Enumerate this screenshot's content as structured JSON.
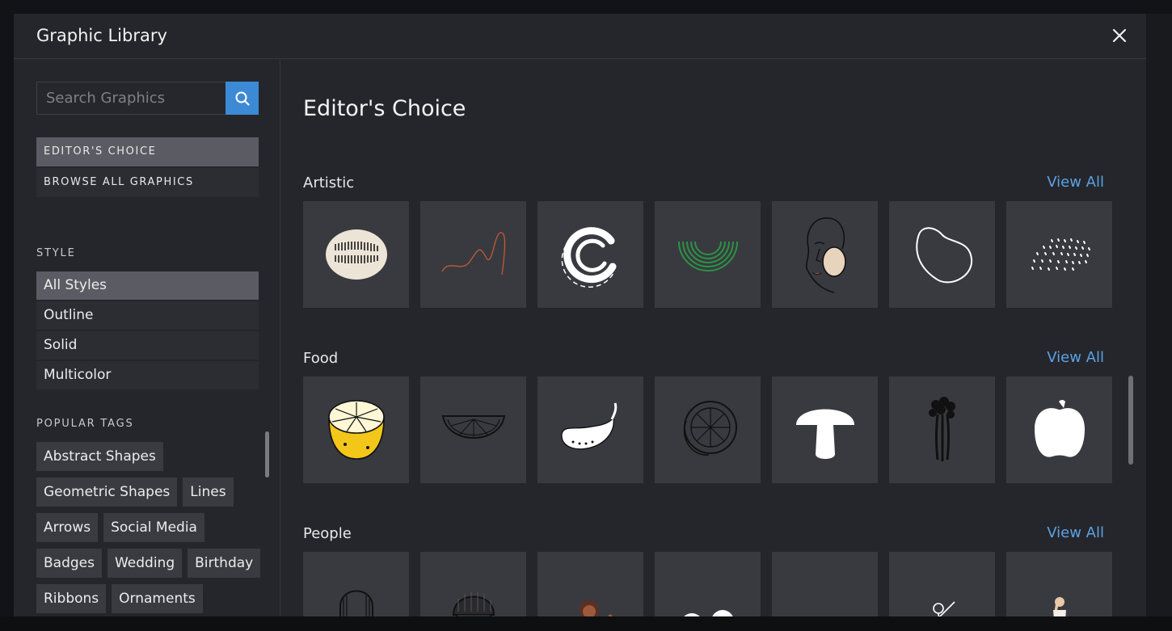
{
  "modal": {
    "title": "Graphic Library"
  },
  "search": {
    "placeholder": "Search Graphics"
  },
  "nav": {
    "items": [
      {
        "label": "EDITOR'S CHOICE"
      },
      {
        "label": "BROWSE ALL GRAPHICS"
      }
    ]
  },
  "style": {
    "heading": "STYLE",
    "items": [
      {
        "label": "All Styles"
      },
      {
        "label": "Outline"
      },
      {
        "label": "Solid"
      },
      {
        "label": "Multicolor"
      }
    ]
  },
  "tags": {
    "heading": "POPULAR TAGS",
    "items": [
      {
        "label": "Abstract Shapes"
      },
      {
        "label": "Geometric Shapes"
      },
      {
        "label": "Lines"
      },
      {
        "label": "Arrows"
      },
      {
        "label": "Social Media"
      },
      {
        "label": "Badges"
      },
      {
        "label": "Wedding"
      },
      {
        "label": "Birthday"
      },
      {
        "label": "Ribbons"
      },
      {
        "label": "Ornaments"
      }
    ]
  },
  "main": {
    "title": "Editor's Choice",
    "view_all_label": "View All",
    "categories": [
      {
        "title": "Artistic",
        "tiles": [
          "abstract-blob-icon",
          "squiggle-line-icon",
          "brush-circle-icon",
          "rainbow-arcs-icon",
          "face-line-art-icon",
          "outline-blob-icon",
          "dots-pattern-icon"
        ]
      },
      {
        "title": "Food",
        "tiles": [
          "lemon-icon",
          "watermelon-slice-icon",
          "eggplant-icon",
          "citrus-slice-icon",
          "mushroom-icon",
          "celery-icon",
          "bell-pepper-icon"
        ]
      },
      {
        "title": "People",
        "tiles": [
          "bearded-man-icon",
          "woman-beanie-icon",
          "woman-waving-icon",
          "two-women-icon",
          "group-people-icon",
          "dancer-icon",
          "standing-woman-icon"
        ]
      }
    ]
  },
  "colors": {
    "accent": "#3c8ad6",
    "link": "#5aa2e4",
    "tile": "#393a40",
    "panel": "#25262b"
  }
}
